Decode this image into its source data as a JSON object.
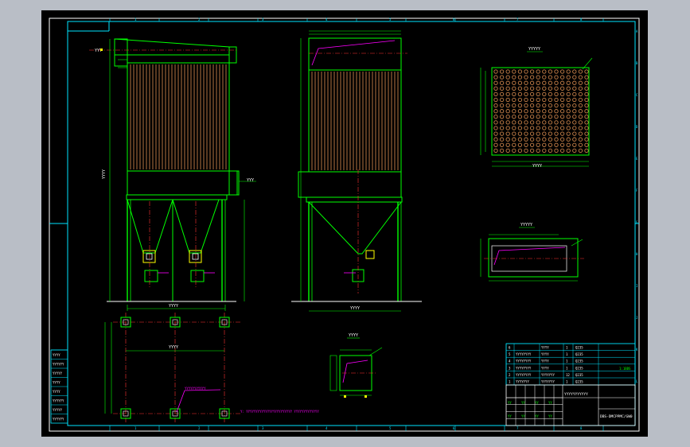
{
  "colors": {
    "page_bg": "#b9bec6",
    "canvas_bg": "#000000",
    "frame": "#ffffff",
    "border": "#00e5ff",
    "outline": "#00ff00",
    "bags": "#c8824a",
    "centerline": "#ff3333",
    "leader": "#ff00ff",
    "text": "#ffffff",
    "annotation": "#ff00ff"
  },
  "views": {
    "top_view_label": "YYYYY",
    "section_view_label": "YYYYY",
    "small_view_label": "YYYY"
  },
  "notes": {
    "foundation_note": "YYYYYYYYYYY",
    "bottom_note": "Y: YYYYYYYYYYYYYYYYYYYYYYYY YYYYYYYYYYYYY"
  },
  "left_table": {
    "rows": [
      "YYYY",
      "YYYYYY",
      "YYYYY",
      "YYYY",
      "YYYY",
      "YYYYYY",
      "YYYYY",
      "YYYYYY"
    ]
  },
  "parts_list": {
    "rows": [
      {
        "no": "6",
        "code": "",
        "name": "YYYY",
        "qty": "1",
        "mat": "Q235"
      },
      {
        "no": "5",
        "code": "YYYYYYYY",
        "name": "YYYY",
        "qty": "1",
        "mat": "Q235"
      },
      {
        "no": "4",
        "code": "YYYYYYYY",
        "name": "YYYY",
        "qty": "1",
        "mat": "Q235"
      },
      {
        "no": "3",
        "code": "YYYYYYYY",
        "name": "YYYY",
        "qty": "1",
        "mat": "Q235"
      },
      {
        "no": "2",
        "code": "YYYYYYYY",
        "name": "YYYYYYY",
        "qty": "12",
        "mat": "Q235"
      },
      {
        "no": "1",
        "code": "YYYYYYY",
        "name": "YYYYYYY",
        "qty": "1",
        "mat": "Q235"
      }
    ],
    "remark": "1:1BBS"
  },
  "title_block": {
    "drawing_title": "YYYYYYYYYYY",
    "drawing_no": "DBS-DMCPPMC/GW0",
    "labels": [
      "YY",
      "YY",
      "YY",
      "YY",
      "YY",
      "YY",
      "YY",
      "YY"
    ]
  },
  "grid_marks": {
    "top": [
      "1",
      "2",
      "3",
      "4",
      "5",
      "6",
      "7",
      "8"
    ],
    "side": [
      "A",
      "B",
      "C",
      "D",
      "E",
      "F",
      "G",
      "H",
      "I",
      "J",
      "K",
      "L"
    ]
  }
}
